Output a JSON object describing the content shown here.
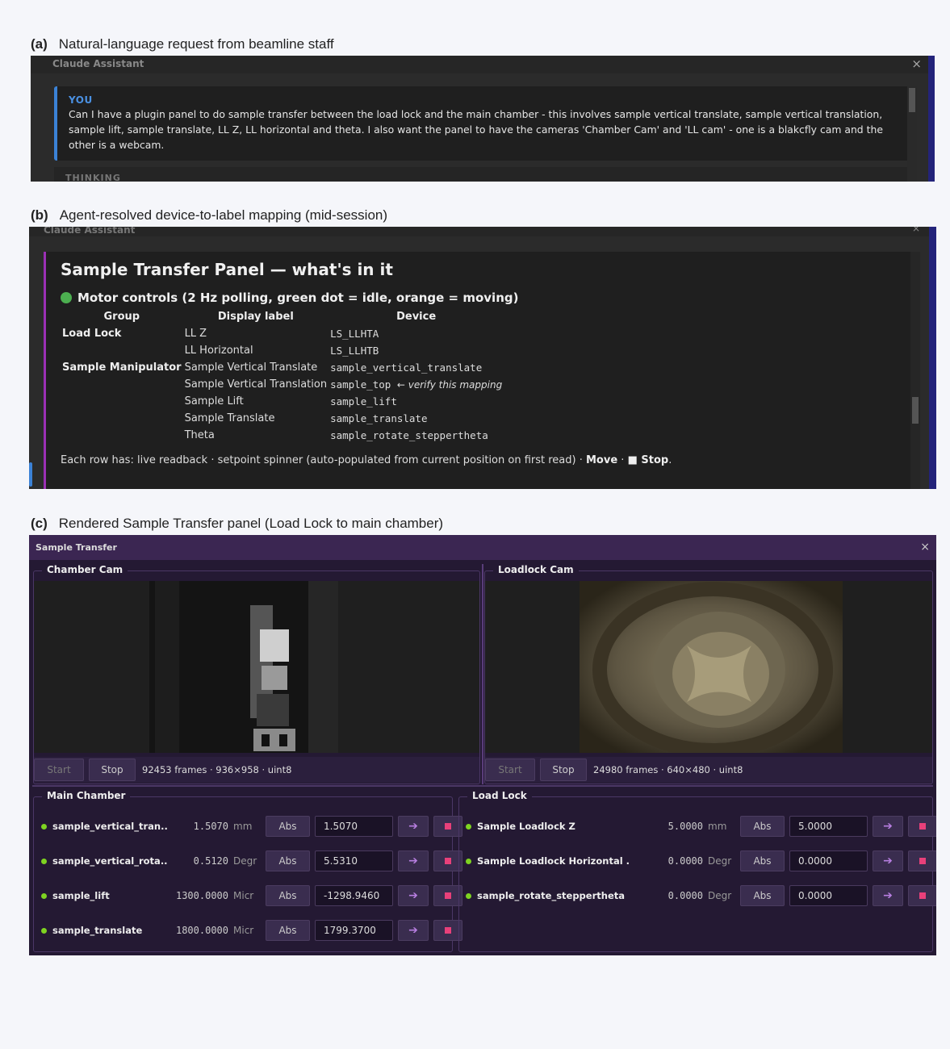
{
  "labels": {
    "a": {
      "letter": "(a)",
      "text": "Natural-language request from beamline staff"
    },
    "b": {
      "letter": "(b)",
      "text": "Agent-resolved device-to-label mapping (mid-session)"
    },
    "c": {
      "letter": "(c)",
      "text": "Rendered Sample Transfer panel (Load Lock to main chamber)"
    }
  },
  "panel_a": {
    "title": "Claude Assistant",
    "close": "×",
    "speaker": "YOU",
    "message": "Can I have a plugin panel to do sample transfer between the load lock and the main chamber - this involves sample vertical translate, sample vertical translation, sample lift, sample translate, LL Z, LL horizontal and theta. I also want the panel to have the cameras 'Chamber Cam' and 'LL cam' - one is a blakcfly cam and the other is a webcam.",
    "thinking": "THINKING"
  },
  "panel_b": {
    "title": "Claude Assistant",
    "close": "×",
    "heading": "Sample Transfer Panel — what's in it",
    "motor_line": "Motor controls (2 Hz polling, green dot = idle, orange = moving)",
    "headers": {
      "group": "Group",
      "label": "Display label",
      "device": "Device"
    },
    "rows": [
      {
        "group": "Load Lock",
        "label": "LL Z",
        "device": "LS_LLHTA",
        "note": ""
      },
      {
        "group": "",
        "label": "LL Horizontal",
        "device": "LS_LLHTB",
        "note": ""
      },
      {
        "group": "Sample Manipulator",
        "label": "Sample Vertical Translate",
        "device": "sample_vertical_translate",
        "note": ""
      },
      {
        "group": "",
        "label": "Sample Vertical Translation",
        "device": "sample_top",
        "note": "← verify this mapping"
      },
      {
        "group": "",
        "label": "Sample Lift",
        "device": "sample_lift",
        "note": ""
      },
      {
        "group": "",
        "label": "Sample Translate",
        "device": "sample_translate",
        "note": ""
      },
      {
        "group": "",
        "label": "Theta",
        "device": "sample_rotate_steppertheta",
        "note": ""
      }
    ],
    "footer_pre": "Each row has: live readback · setpoint spinner (auto-populated from current position on first read) · ",
    "footer_move": "Move",
    "footer_sep": " · ",
    "footer_stop": "■ Stop",
    "footer_end": "."
  },
  "panel_c": {
    "title": "Sample Transfer",
    "close": "×",
    "cams": [
      {
        "title": "Chamber Cam",
        "start": "Start",
        "stop": "Stop",
        "info": "92453 frames · 936×958 · uint8"
      },
      {
        "title": "Loadlock Cam",
        "start": "Start",
        "stop": "Stop",
        "info": "24980 frames · 640×480 · uint8"
      }
    ],
    "main_chamber": {
      "title": "Main Chamber",
      "rows": [
        {
          "name": "sample_vertical_tran...",
          "value": "1.5070",
          "unit": "mm",
          "abs": "Abs",
          "setpoint": "1.5070"
        },
        {
          "name": "sample_vertical_rota...",
          "value": "0.5120",
          "unit": "Degr",
          "abs": "Abs",
          "setpoint": "5.5310"
        },
        {
          "name": "sample_lift",
          "value": "1300.0000",
          "unit": "Micr",
          "abs": "Abs",
          "setpoint": "-1298.9460"
        },
        {
          "name": "sample_translate",
          "value": "1800.0000",
          "unit": "Micr",
          "abs": "Abs",
          "setpoint": "1799.3700"
        }
      ]
    },
    "load_lock": {
      "title": "Load Lock",
      "rows": [
        {
          "name": "Sample Loadlock Z",
          "value": "5.0000",
          "unit": "mm",
          "abs": "Abs",
          "setpoint": "5.0000"
        },
        {
          "name": "Sample Loadlock Horizontal ...",
          "value": "0.0000",
          "unit": "Degr",
          "abs": "Abs",
          "setpoint": "0.0000"
        },
        {
          "name": "sample_rotate_steppertheta",
          "value": "0.0000",
          "unit": "Degr",
          "abs": "Abs",
          "setpoint": "0.0000"
        }
      ]
    },
    "colors": {
      "idle": "#7ed321",
      "stop": "#e8407a",
      "move": "#b77ee0",
      "accent": "#9b30b5"
    }
  }
}
